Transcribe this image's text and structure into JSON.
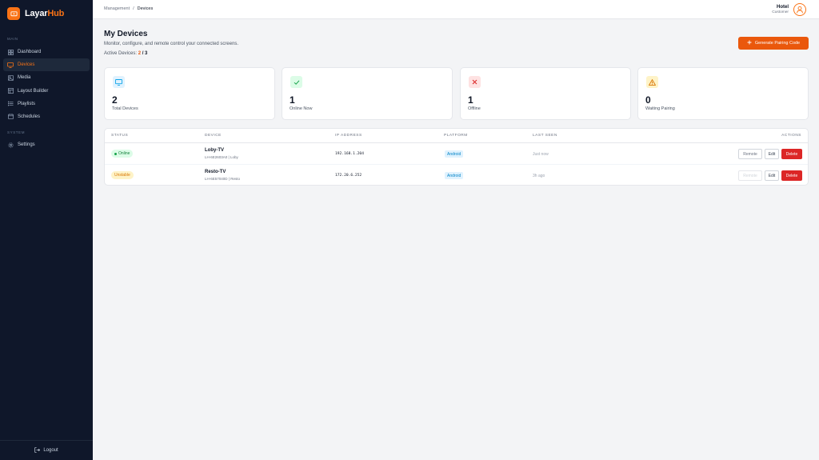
{
  "brand": {
    "name_main": "Layar",
    "name_accent": "Hub"
  },
  "sidebar": {
    "main_label": "MAIN",
    "system_label": "SYSTEM",
    "items": [
      {
        "label": "Dashboard",
        "icon": "grid-icon"
      },
      {
        "label": "Devices",
        "icon": "monitor-icon",
        "active": true
      },
      {
        "label": "Media",
        "icon": "image-icon"
      },
      {
        "label": "Layout Builder",
        "icon": "layout-icon"
      },
      {
        "label": "Playlists",
        "icon": "list-icon"
      },
      {
        "label": "Schedules",
        "icon": "calendar-icon"
      }
    ],
    "system_items": [
      {
        "label": "Settings",
        "icon": "gear-icon"
      }
    ],
    "logout_label": "Logout"
  },
  "topbar": {
    "breadcrumb": [
      "Management",
      "/",
      "Devices"
    ],
    "user_name": "Hotel",
    "user_role": "Customer"
  },
  "header": {
    "title": "My Devices",
    "subtitle": "Monitor, configure, and remote control your connected screens.",
    "active_label": "Active Devices:",
    "active_count": "2",
    "active_sep": "/",
    "active_total": "3",
    "generate_button": "Generate Pairing Code"
  },
  "stats": [
    {
      "value": "2",
      "label": "Total Devices",
      "icon": "monitor-icon",
      "color": "#0ea5e9",
      "bg": "#e0f2fe"
    },
    {
      "value": "1",
      "label": "Online Now",
      "icon": "check-icon",
      "color": "#16a34a",
      "bg": "#dcfce7"
    },
    {
      "value": "1",
      "label": "Offline",
      "icon": "x-icon",
      "color": "#dc2626",
      "bg": "#fee2e2"
    },
    {
      "value": "0",
      "label": "Waiting Pairing",
      "icon": "warning-icon",
      "color": "#d97706",
      "bg": "#fef3c7"
    }
  ],
  "table": {
    "columns": [
      "STATUS",
      "DEVICE",
      "IP ADDRESS",
      "PLATFORM",
      "LAST SEEN",
      "ACTIONS"
    ],
    "rows": [
      {
        "status": "Online",
        "name": "Loby-TV",
        "sub": "LH-6E2603A0 | Loby",
        "ip": "192.168.1.204",
        "platform": "Android",
        "last_seen": "Just now",
        "remote": "Remote",
        "edit": "Edit",
        "delete": "Delete"
      },
      {
        "status": "Unstable",
        "name": "Resto-TV",
        "sub": "LH-6E57040D | Resto",
        "ip": "172.20.6.252",
        "platform": "Android",
        "last_seen": "3h ago",
        "remote": "Remote",
        "edit": "Edit",
        "delete": "Delete"
      }
    ]
  },
  "colors": {
    "accent": "#ea580c",
    "sidebar_bg": "#0f172a",
    "danger": "#dc2626"
  }
}
